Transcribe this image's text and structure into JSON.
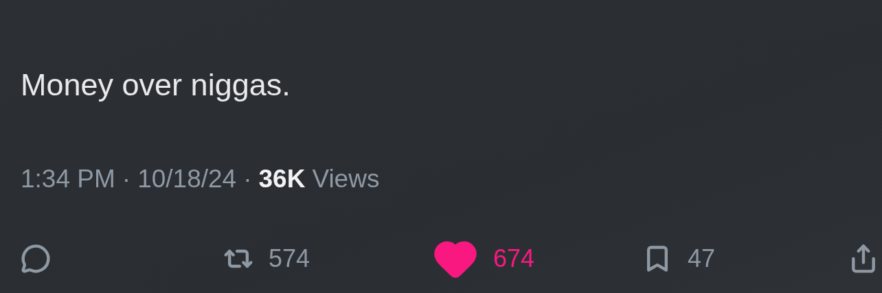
{
  "tweet": {
    "text": "Money over niggas."
  },
  "meta": [
    {
      "kind": "text",
      "text": "1:34 PM"
    },
    {
      "kind": "dot",
      "text": "·"
    },
    {
      "kind": "text",
      "text": "10/18/24"
    },
    {
      "kind": "dot",
      "text": "·"
    },
    {
      "kind": "strong",
      "text": "36K"
    },
    {
      "kind": "text",
      "text": "Views"
    }
  ],
  "actions": [
    {
      "kind": "reply"
    },
    {
      "kind": "retweet",
      "count": "574",
      "selected": false
    },
    {
      "kind": "like",
      "count": "674",
      "selected": true
    },
    {
      "kind": "bookmark",
      "count": "47",
      "selected": false
    },
    {
      "kind": "share"
    }
  ]
}
